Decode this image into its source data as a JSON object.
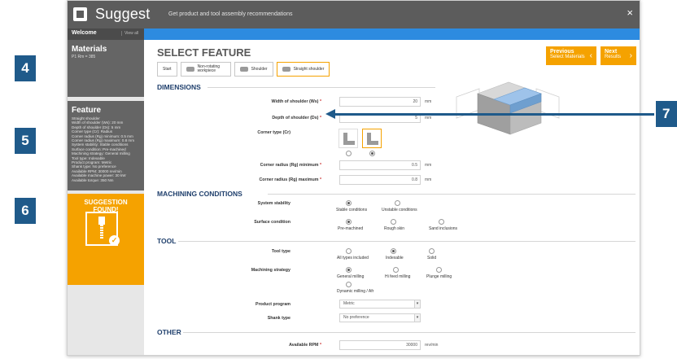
{
  "callouts": [
    "4",
    "5",
    "6",
    "7"
  ],
  "window": {
    "title": "Suggest",
    "subtitle": "Get product and tool assembly recommendations",
    "close": "×"
  },
  "welcome": {
    "label": "Welcome",
    "view_all": "View all"
  },
  "sidebar": {
    "materials": {
      "title": "Materials",
      "sub": "P1 Rm = 385"
    },
    "feature": {
      "title": "Feature",
      "lines": [
        "Straight shoulder",
        "Width of shoulder (Ws): 20 mm",
        "Depth of shoulder (Ds): 5 mm",
        "Corner type (Cr): Radius",
        "Corner radius (Rg) minimum: 0.5 mm",
        "Corner radius (Rg) maximum: 0.8 mm",
        "System stability: Stable conditions",
        "Surface condition: Pre-machined",
        "Machining strategy: General milling",
        "Tool type: Indexable",
        "Product program: Metric",
        "Shank type: No preference",
        "Available RPM: 30000 rev/min",
        "Available machine power: 30 kW",
        "Available torque: 350 Nm"
      ]
    },
    "suggestion": {
      "title": "SUGGESTION FOUND!"
    }
  },
  "main": {
    "title": "SELECT FEATURE",
    "prev": {
      "big": "Previous",
      "small": "Select Materials",
      "arrow": "‹"
    },
    "next": {
      "big": "Next",
      "small": "Results",
      "arrow": "›"
    },
    "breadcrumb": [
      "Start",
      "Non-rotating workpiece",
      "Shoulder",
      "Straight shoulder"
    ],
    "dimensions": {
      "heading": "DIMENSIONS",
      "width": {
        "label": "Width of shoulder (Ws)",
        "value": "20",
        "unit": "mm"
      },
      "depth": {
        "label": "Depth of shoulder (Ds)",
        "value": "5",
        "unit": "mm"
      },
      "corner_type": {
        "label": "Corner type (Cr)",
        "selected": 1
      },
      "rmin": {
        "label": "Corner radius (Rg) minimum",
        "value": "0.5",
        "unit": "mm"
      },
      "rmax": {
        "label": "Corner radius (Rg) maximum",
        "value": "0.8",
        "unit": "mm"
      }
    },
    "machining": {
      "heading": "MACHINING CONDITIONS",
      "stability": {
        "label": "System stability",
        "options": [
          "Stable conditions",
          "Unstable conditions"
        ],
        "selected": 0
      },
      "surface": {
        "label": "Surface condition",
        "options": [
          "Pre-machined",
          "Rough skin",
          "Sand inclusions"
        ],
        "selected": 0
      }
    },
    "tool": {
      "heading": "TOOL",
      "type": {
        "label": "Tool type",
        "options": [
          "All types included",
          "Indexable",
          "Solid"
        ],
        "selected": 1
      },
      "strategy": {
        "label": "Machining strategy",
        "options": [
          "General milling",
          "Hi feed milling",
          "Plunge milling",
          "Dynamic milling / Afr"
        ],
        "selected": 0
      },
      "program": {
        "label": "Product program",
        "value": "Metric"
      },
      "shank": {
        "label": "Shank type",
        "value": "No preference"
      }
    },
    "other": {
      "heading": "OTHER",
      "rpm": {
        "label": "Available RPM",
        "value": "30000",
        "unit": "rev/min"
      }
    }
  },
  "required_mark": "*",
  "caret": "▾",
  "colors": {
    "accent": "#f5a200",
    "blue_bar": "#2d8be0",
    "callout": "#1f5a8a",
    "heading": "#1f3f6c"
  }
}
